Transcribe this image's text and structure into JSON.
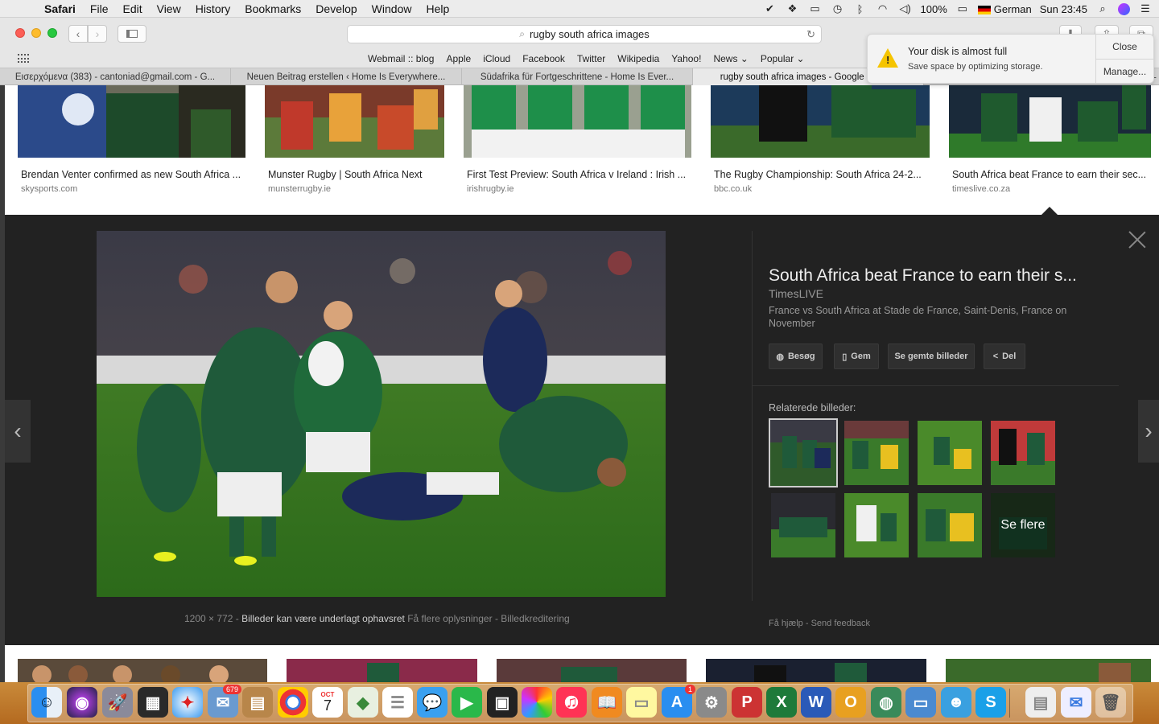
{
  "menubar": {
    "app": "Safari",
    "items": [
      "File",
      "Edit",
      "View",
      "History",
      "Bookmarks",
      "Develop",
      "Window",
      "Help"
    ],
    "battery": "100%",
    "input_source": "German",
    "clock": "Sun 23:45"
  },
  "toolbar": {
    "url": "rugby south africa images"
  },
  "favorites": [
    "Webmail :: blog",
    "Apple",
    "iCloud",
    "Facebook",
    "Twitter",
    "Wikipedia",
    "Yahoo!",
    "News ⌄",
    "Popular ⌄"
  ],
  "tabs": [
    "Εισερχόμενα (383) - cantoniad@gmail.com - G...",
    "Neuen Beitrag erstellen ‹ Home Is Everywhere...",
    "Südafrika für Fortgeschrittene - Home Is Ever...",
    "rugby south africa images - Google Search"
  ],
  "notification": {
    "title": "Your disk is almost full",
    "body": "Save space by optimizing storage.",
    "close": "Close",
    "manage": "Manage..."
  },
  "results": [
    {
      "title": "Brendan Venter confirmed as new South Africa ...",
      "source": "skysports.com"
    },
    {
      "title": "Munster Rugby | South Africa Next",
      "source": "munsterrugby.ie"
    },
    {
      "title": "First Test Preview: South Africa v Ireland : Irish ...",
      "source": "irishrugby.ie"
    },
    {
      "title": "The Rugby Championship: South Africa 24-2...",
      "source": "bbc.co.uk"
    },
    {
      "title": "South Africa beat France to earn their sec...",
      "source": "timeslive.co.za"
    }
  ],
  "preview": {
    "title": "South Africa beat France to earn their s...",
    "source": "TimesLIVE",
    "description": "France vs South Africa at Stade de France, Saint-Denis, France on November",
    "buttons": {
      "visit": "Besøg",
      "save": "Gem",
      "saved": "Se gemte billeder",
      "share": "Del"
    },
    "related_label": "Relaterede billeder:",
    "see_more": "Se flere",
    "size": "1200 × 772",
    "copyright": "Billeder kan være underlagt ophavsret",
    "more_info": "Få flere oplysninger",
    "credit": "Billedkreditering",
    "help": "Få hjælp",
    "feedback": "Send feedback",
    "sep": "-"
  },
  "dock": {
    "photos_badge": "679",
    "calendar_month": "OCT",
    "calendar_day": "7",
    "appstore_badge": "1"
  }
}
